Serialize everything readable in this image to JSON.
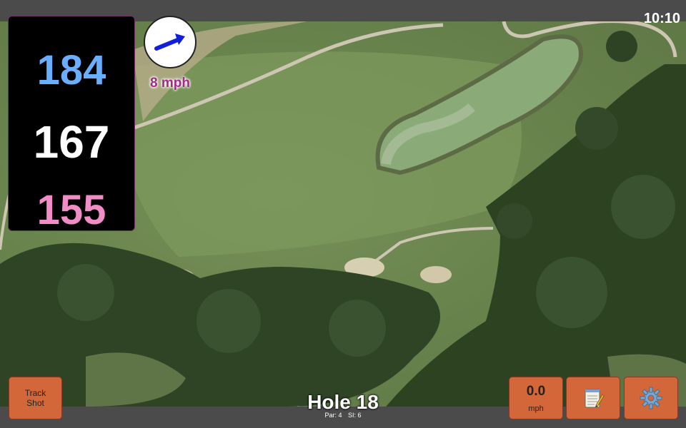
{
  "status": {
    "time": "10:10"
  },
  "distances": {
    "back": "184",
    "middle": "167",
    "front": "155"
  },
  "wind": {
    "speed_label": "8 mph",
    "direction_icon": "arrow-right-icon"
  },
  "hole": {
    "title": "Hole 18",
    "par_label": "Par: 4",
    "si_label": "SI: 6"
  },
  "buttons": {
    "track_line1": "Track",
    "track_line2": "Shot",
    "speed_value": "0.0",
    "speed_unit": "mph",
    "notes_icon": "notepad-icon",
    "settings_icon": "gear-icon"
  },
  "colors": {
    "back_distance": "#6aaeff",
    "middle_distance": "#ffffff",
    "front_distance": "#f08cc6",
    "wind_text": "#a22b87",
    "button_orange": "#d4673a"
  }
}
